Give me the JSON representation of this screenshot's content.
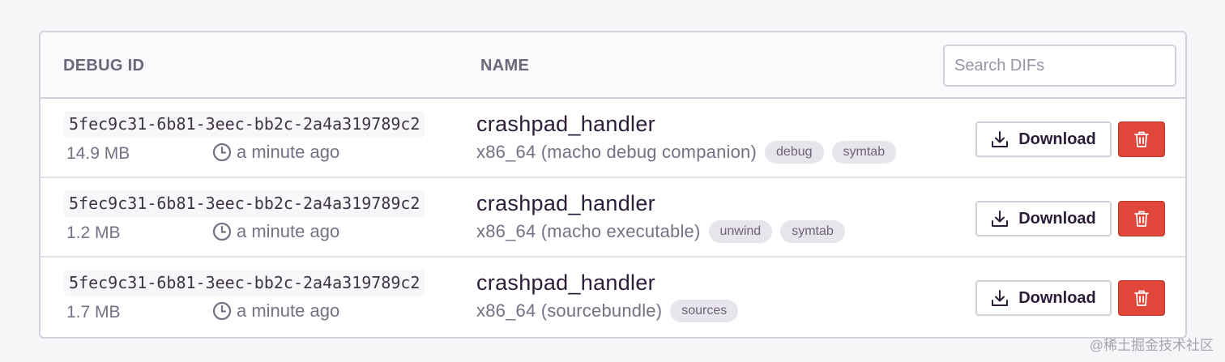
{
  "header": {
    "debug_id_label": "DEBUG ID",
    "name_label": "NAME",
    "search_placeholder": "Search DIFs"
  },
  "rows": [
    {
      "debug_id": "5fec9c31-6b81-3eec-bb2c-2a4a319789c2",
      "size": "14.9 MB",
      "time": "a minute ago",
      "name": "crashpad_handler",
      "arch": "x86_64 (macho debug companion)",
      "tags": [
        "debug",
        "symtab"
      ],
      "download_label": "Download"
    },
    {
      "debug_id": "5fec9c31-6b81-3eec-bb2c-2a4a319789c2",
      "size": "1.2 MB",
      "time": "a minute ago",
      "name": "crashpad_handler",
      "arch": "x86_64 (macho executable)",
      "tags": [
        "unwind",
        "symtab"
      ],
      "download_label": "Download"
    },
    {
      "debug_id": "5fec9c31-6b81-3eec-bb2c-2a4a319789c2",
      "size": "1.7 MB",
      "time": "a minute ago",
      "name": "crashpad_handler",
      "arch": "x86_64 (sourcebundle)",
      "tags": [
        "sources"
      ],
      "download_label": "Download"
    }
  ],
  "icons": {
    "time": "clock-icon",
    "download": "download-icon",
    "delete": "trash-icon"
  },
  "colors": {
    "delete_button": "#e0473a",
    "tag_background": "#e7e4eb"
  },
  "watermark": "@稀土掘金技术社区"
}
